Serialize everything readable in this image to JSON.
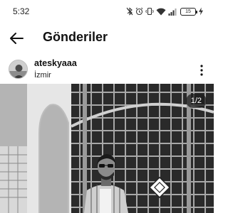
{
  "status_bar": {
    "time": "5:32",
    "battery_level": "15",
    "icons": [
      "bluetooth-off-icon",
      "alarm-icon",
      "vibrate-icon",
      "wifi-icon",
      "signal-icon",
      "battery-icon",
      "charging-icon"
    ]
  },
  "header": {
    "back_icon": "arrow-left-icon",
    "title": "Gönderiler"
  },
  "post": {
    "username": "ateskyaaa",
    "location": "İzmir",
    "more_icon": "more-vertical-icon",
    "image_counter": "1/2",
    "image_current": 1,
    "image_total": 2
  },
  "colors": {
    "text": "#111111",
    "background": "#ffffff",
    "badge_bg": "#1e1e1e"
  }
}
